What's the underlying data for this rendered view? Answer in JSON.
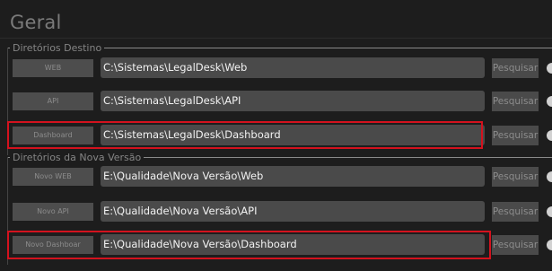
{
  "page": {
    "title": "Geral"
  },
  "groups": [
    {
      "label": "Diretórios Destino",
      "rows": [
        {
          "button": "WEB",
          "path": "C:\\Sistemas\\LegalDesk\\Web",
          "search": "Pesquisar"
        },
        {
          "button": "API",
          "path": "C:\\Sistemas\\LegalDesk\\API",
          "search": "Pesquisar"
        },
        {
          "button": "Dashboard",
          "path": "C:\\Sistemas\\LegalDesk\\Dashboard",
          "search": "Pesquisar"
        }
      ]
    },
    {
      "label": "Diretórios da Nova Versão",
      "rows": [
        {
          "button": "Novo WEB",
          "path": "E:\\Qualidade\\Nova Versão\\Web",
          "search": "Pesquisar"
        },
        {
          "button": "Novo API",
          "path": "E:\\Qualidade\\Nova Versão\\API",
          "search": "Pesquisar"
        },
        {
          "button": "Novo Dashboar",
          "path": "E:\\Qualidade\\Nova Versão\\Dashboard",
          "search": "Pesquisar"
        }
      ]
    }
  ],
  "colors": {
    "background": "#1d1d1d",
    "field": "#4a4a4a",
    "highlight": "#d3121e"
  }
}
